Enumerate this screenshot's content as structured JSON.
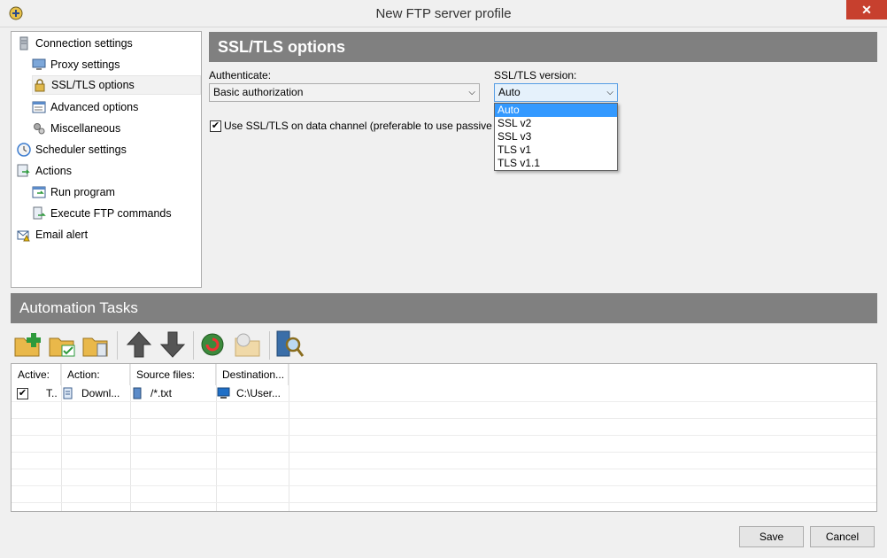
{
  "window": {
    "title": "New FTP server profile",
    "close_label": "✕"
  },
  "tree": {
    "items": [
      {
        "label": "Connection settings"
      },
      {
        "label": "Proxy settings"
      },
      {
        "label": "SSL/TLS options"
      },
      {
        "label": "Advanced options"
      },
      {
        "label": "Miscellaneous"
      },
      {
        "label": "Scheduler settings"
      },
      {
        "label": "Actions"
      },
      {
        "label": "Run program"
      },
      {
        "label": "Execute FTP commands"
      },
      {
        "label": "Email alert"
      }
    ],
    "selected": "SSL/TLS options"
  },
  "ssl_panel": {
    "title": "SSL/TLS options",
    "authenticate_label": "Authenticate:",
    "authenticate_value": "Basic authorization",
    "version_label": "SSL/TLS version:",
    "version_value": "Auto",
    "version_options": [
      "Auto",
      "SSL v2",
      "SSL v3",
      "TLS v1",
      "TLS v1.1"
    ],
    "use_ssl_data_label": "Use SSL/TLS on data channel (preferable to use passive mo",
    "use_ssl_data_checked": true,
    "check_mark": "✔"
  },
  "automation": {
    "title": "Automation Tasks",
    "columns": [
      "Active:",
      "Action:",
      "Source files:",
      "Destination..."
    ],
    "rows": [
      {
        "active_text": "T..",
        "action": "Downl...",
        "source": "/*.txt",
        "destination": "C:\\User..."
      }
    ]
  },
  "buttons": {
    "save": "Save",
    "cancel": "Cancel"
  },
  "colors": {
    "header_gray": "#808080",
    "highlight": "#3399ff",
    "close_red": "#c7402e"
  }
}
